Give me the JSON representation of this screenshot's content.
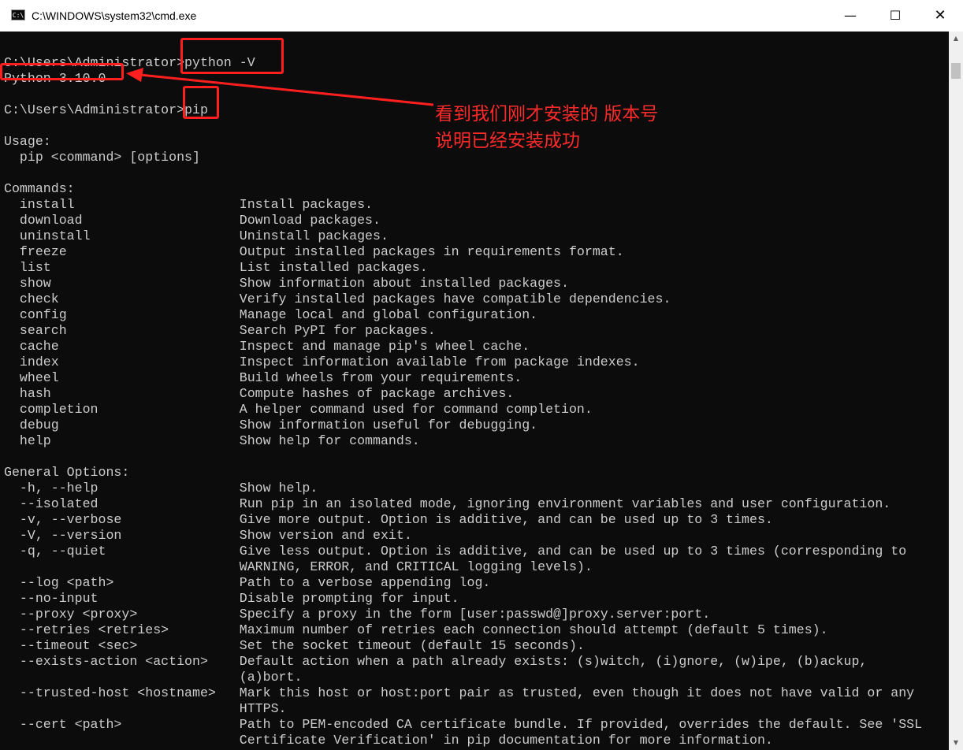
{
  "window": {
    "title": "C:\\WINDOWS\\system32\\cmd.exe",
    "icon_text": "C:\\",
    "controls": {
      "minimize": "—",
      "maximize": "☐",
      "close": "✕"
    }
  },
  "console": {
    "lines": [
      "",
      "C:\\Users\\Administrator>python -V",
      "Python 3.10.0",
      "",
      "C:\\Users\\Administrator>pip",
      "",
      "Usage:",
      "  pip <command> [options]",
      "",
      "Commands:",
      "  install                     Install packages.",
      "  download                    Download packages.",
      "  uninstall                   Uninstall packages.",
      "  freeze                      Output installed packages in requirements format.",
      "  list                        List installed packages.",
      "  show                        Show information about installed packages.",
      "  check                       Verify installed packages have compatible dependencies.",
      "  config                      Manage local and global configuration.",
      "  search                      Search PyPI for packages.",
      "  cache                       Inspect and manage pip's wheel cache.",
      "  index                       Inspect information available from package indexes.",
      "  wheel                       Build wheels from your requirements.",
      "  hash                        Compute hashes of package archives.",
      "  completion                  A helper command used for command completion.",
      "  debug                       Show information useful for debugging.",
      "  help                        Show help for commands.",
      "",
      "General Options:",
      "  -h, --help                  Show help.",
      "  --isolated                  Run pip in an isolated mode, ignoring environment variables and user configuration.",
      "  -v, --verbose               Give more output. Option is additive, and can be used up to 3 times.",
      "  -V, --version               Show version and exit.",
      "  -q, --quiet                 Give less output. Option is additive, and can be used up to 3 times (corresponding to",
      "                              WARNING, ERROR, and CRITICAL logging levels).",
      "  --log <path>                Path to a verbose appending log.",
      "  --no-input                  Disable prompting for input.",
      "  --proxy <proxy>             Specify a proxy in the form [user:passwd@]proxy.server:port.",
      "  --retries <retries>         Maximum number of retries each connection should attempt (default 5 times).",
      "  --timeout <sec>             Set the socket timeout (default 15 seconds).",
      "  --exists-action <action>    Default action when a path already exists: (s)witch, (i)gnore, (w)ipe, (b)ackup,",
      "                              (a)bort.",
      "  --trusted-host <hostname>   Mark this host or host:port pair as trusted, even though it does not have valid or any",
      "                              HTTPS.",
      "  --cert <path>               Path to PEM-encoded CA certificate bundle. If provided, overrides the default. See 'SSL",
      "                              Certificate Verification' in pip documentation for more information."
    ]
  },
  "annotation": {
    "line1": "看到我们刚才安装的 版本号",
    "line2": "说明已经安装成功",
    "color": "#ff2a2a"
  },
  "colors": {
    "console_bg": "#0c0c0c",
    "console_text": "#cccccc",
    "highlight": "#ff1f1f"
  }
}
